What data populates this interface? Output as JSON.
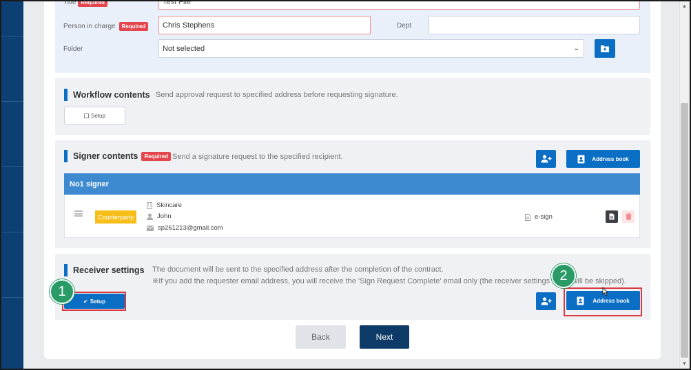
{
  "form": {
    "title_label": "Title",
    "title_required": "Required",
    "title_value": "Test File",
    "person_label": "Person in charge",
    "person_required": "Required",
    "person_value": "Chris Stephens",
    "dept_label": "Dept",
    "dept_value": "",
    "folder_label": "Folder",
    "folder_value": "Not selected"
  },
  "workflow": {
    "title": "Workflow contents",
    "description": "Send approval request to specified address before requesting signature.",
    "setup_label": "Setup"
  },
  "signer": {
    "title": "Signer contents",
    "required": "Required",
    "description": "Send a signature request to the specified recipient.",
    "address_book_label": "Address book",
    "header": "No1 signer",
    "badge": "Counterparty",
    "company": "Skincare",
    "name": "John",
    "email": "sp261213@gmail.com",
    "method": "e-sign"
  },
  "receiver": {
    "title": "Receiver settings",
    "description_line1": "The document will be sent to the specified address after the completion of the contract.",
    "description_line2": "※If you add the requester email address, you will receive the 'Sign Request Complete' email only (the receiver settings email will be skipped).",
    "setup_label": "Setup",
    "address_book_label": "Address book"
  },
  "nav": {
    "back_label": "Back",
    "next_label": "Next"
  },
  "annotations": {
    "marker1": "1",
    "marker2": "2"
  },
  "colors": {
    "accent": "#0a6ec4",
    "required": "#e5454d",
    "badge": "#f7be1a",
    "marker": "#2a9a66",
    "highlight": "#d9393f"
  }
}
